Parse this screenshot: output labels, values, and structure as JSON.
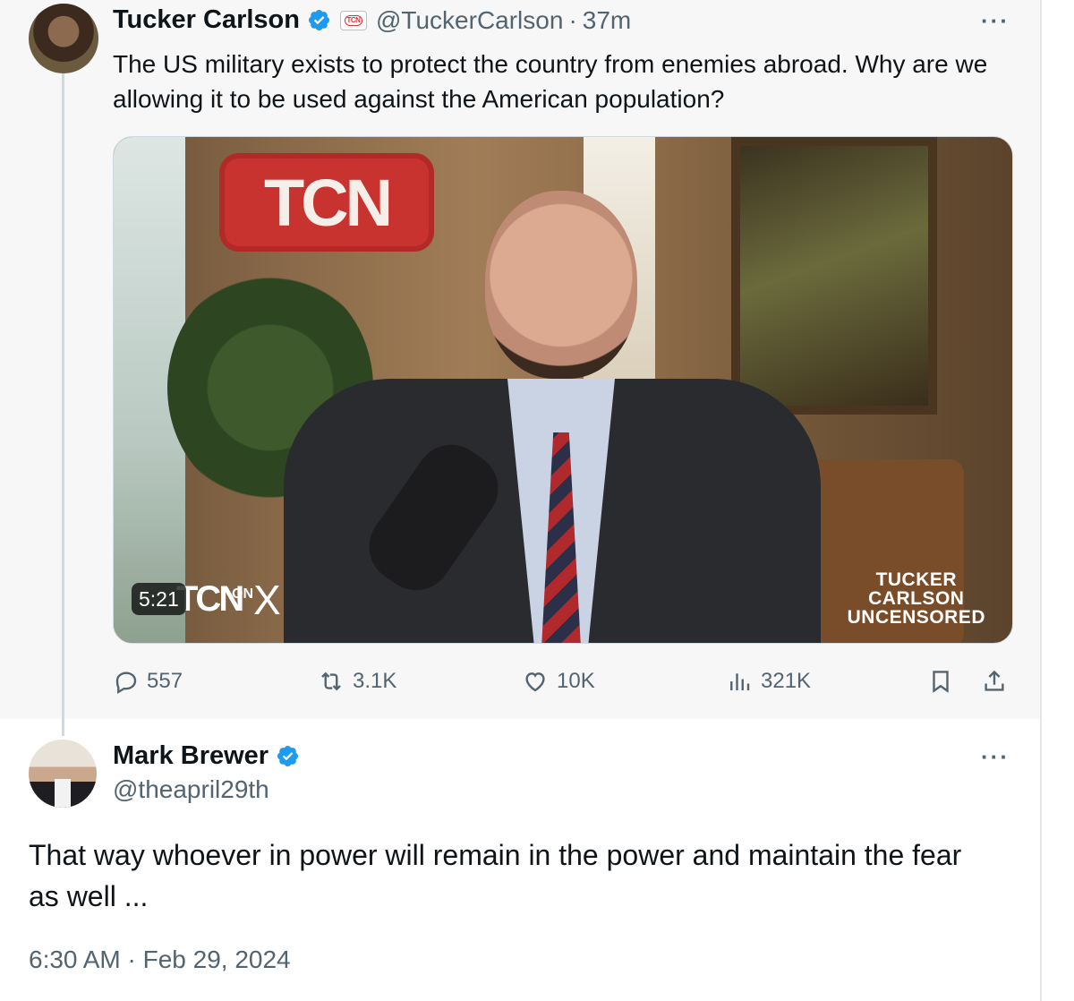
{
  "quoted_tweet": {
    "author_name": "Tucker Carlson",
    "affiliate_badge": "TCN",
    "handle": "@TuckerCarlson",
    "separator": "·",
    "time": "37m",
    "text": "The US military exists to protect the country from enemies abroad. Why are we allowing it to be used against the American population?",
    "media": {
      "sign_text": "TCN",
      "duration": "5:21",
      "logo_text": "TCN",
      "logo_on": "ON",
      "logo_x": "X",
      "brand_lines": [
        "TUCKER",
        "CARLSON",
        "UNCENSORED"
      ]
    },
    "stats": {
      "replies": "557",
      "reposts": "3.1K",
      "likes": "10K",
      "views": "321K"
    },
    "more_label": "···"
  },
  "reply_tweet": {
    "author_name": "Mark Brewer",
    "handle": "@theapril29th",
    "text": "That way whoever in power will remain in the power and maintain the fear as well ...",
    "timestamp": "6:30 AM · Feb 29, 2024",
    "more_label": "···"
  },
  "colors": {
    "verified_blue": "#1d9bf0",
    "secondary_text": "#536471",
    "primary_text": "#0f1419",
    "thread_line": "#cfd9de"
  },
  "icons": {
    "verified": "verified-badge-icon",
    "reply": "reply-icon",
    "repost": "repost-icon",
    "like": "heart-icon",
    "views": "views-chart-icon",
    "bookmark": "bookmark-icon",
    "share": "share-icon",
    "more": "more-icon"
  }
}
